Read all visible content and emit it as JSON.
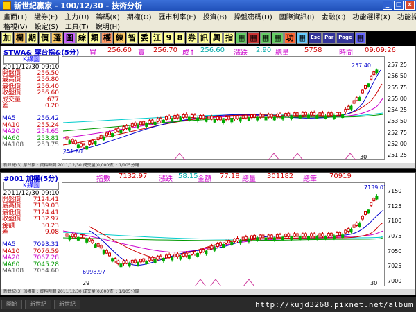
{
  "window": {
    "title": "新世紀贏家 - 100/12/30 - 技術分析",
    "buttons": [
      "_",
      "□",
      "×"
    ]
  },
  "menus": {
    "row1": [
      "畫面(1)",
      "證券(E)",
      "主力(U)",
      "籌碼(K)",
      "期權(O)",
      "匯市利率(E)",
      "投資(B)",
      "操盤密碼(D)",
      "國際資訊(I)",
      "金融(C)",
      "功能選擇(X)",
      "功能操作(T)"
    ],
    "row2": [
      "格視(V)",
      "設定(S)",
      "工具(T)",
      "說明(H)"
    ]
  },
  "toolbar": [
    "加",
    "欄",
    "期",
    "價",
    "選",
    "圖",
    "綜",
    "類",
    "權",
    "練",
    "智",
    "委",
    "江",
    "9",
    "8",
    "券",
    "訊",
    "興",
    "指",
    "▦",
    "▦",
    "▦",
    "▦",
    "功",
    "▦",
    "Esc",
    "Par",
    "Page",
    "▦"
  ],
  "panel1": {
    "symbol": "STWA& 摩台指&(5分)",
    "bid_label": "買",
    "bid": "256.60",
    "ask_label": "賣",
    "ask": "256.70",
    "last_label": "成↑",
    "last": "256.60",
    "change_label": "漲跌",
    "change": "2.90",
    "volume_label": "總量",
    "volume": "5758",
    "time_label": "時間",
    "time": "09:09:26",
    "ktitle": "K線圖",
    "date": "2011/12/30 09:10",
    "stats": [
      {
        "label": "開盤價",
        "value": "256.50",
        "color": "#cc0000"
      },
      {
        "label": "最高價",
        "value": "256.80",
        "color": "#cc0000"
      },
      {
        "label": "最低價",
        "value": "256.40",
        "color": "#cc0000"
      },
      {
        "label": "收盤價",
        "value": "256.60",
        "color": "#cc0000"
      },
      {
        "label": "成交量",
        "value": "677",
        "color": "#cc0000"
      },
      {
        "label": "差",
        "value": "0.20",
        "color": "#cc0000"
      }
    ],
    "ma": [
      {
        "label": "MA5",
        "value": "256.42",
        "color": "#0000cc"
      },
      {
        "label": "MA10",
        "value": "255.24",
        "color": "#cc0000"
      },
      {
        "label": "MA20",
        "value": "254.65",
        "color": "#cc00cc"
      },
      {
        "label": "MA60",
        "value": "253.81",
        "color": "#009900"
      },
      {
        "label": "MA108",
        "value": "253.75",
        "color": "#555555"
      }
    ],
    "axis": [
      "257.25",
      "256.50",
      "255.75",
      "255.00",
      "254.25",
      "253.50",
      "252.75",
      "252.00",
      "251.25"
    ],
    "high_mark": "257.40",
    "low_mark": "251.80",
    "date_tick": "30",
    "status": "新世紀(3) 摩台指 : 資料時間 2011/12/30 成交量(0,000張) : 1/105分鐘"
  },
  "panel2": {
    "symbol": "#001 加權(5分)",
    "index_label": "指數",
    "index": "7132.97",
    "change_label": "漲跌",
    "change": "58.15",
    "amount_label": "金額",
    "amount": "77.18",
    "volume_label": "總量",
    "volume": "301182",
    "trades_label": "總筆",
    "trades": "70919",
    "ktitle": "K線圖",
    "date": "2011/12/30 09:10",
    "stats": [
      {
        "label": "開盤價",
        "value": "7124.41",
        "color": "#cc0000"
      },
      {
        "label": "最高價",
        "value": "7139.03",
        "color": "#cc0000"
      },
      {
        "label": "最低價",
        "value": "7124.41",
        "color": "#cc0000"
      },
      {
        "label": "收盤價",
        "value": "7132.97",
        "color": "#cc0000"
      },
      {
        "label": "金額",
        "value": "30.23",
        "color": "#cc0000"
      },
      {
        "label": "差",
        "value": "9.08",
        "color": "#cc0000"
      }
    ],
    "ma": [
      {
        "label": "MA5",
        "value": "7093.31",
        "color": "#0000cc"
      },
      {
        "label": "MA10",
        "value": "7076.59",
        "color": "#cc0000"
      },
      {
        "label": "MA20",
        "value": "7067.28",
        "color": "#cc00cc"
      },
      {
        "label": "MA60",
        "value": "7045.28",
        "color": "#009900"
      },
      {
        "label": "MA108",
        "value": "7054.60",
        "color": "#555555"
      }
    ],
    "axis": [
      "7150",
      "7125",
      "7100",
      "7075",
      "7050",
      "7025",
      "7000"
    ],
    "high_mark": "7139.03",
    "low_mark": "6998.97",
    "date_ticks": [
      "29",
      "30"
    ],
    "status": "新世紀(3) 加權指 : 資料時間 2011/12/30 成交量(0,000張) : 1/105分鐘"
  },
  "taskbar": [
    "開始",
    "新世紀",
    "新世紀"
  ],
  "watermark": "http://kujd3268.pixnet.net/album"
}
